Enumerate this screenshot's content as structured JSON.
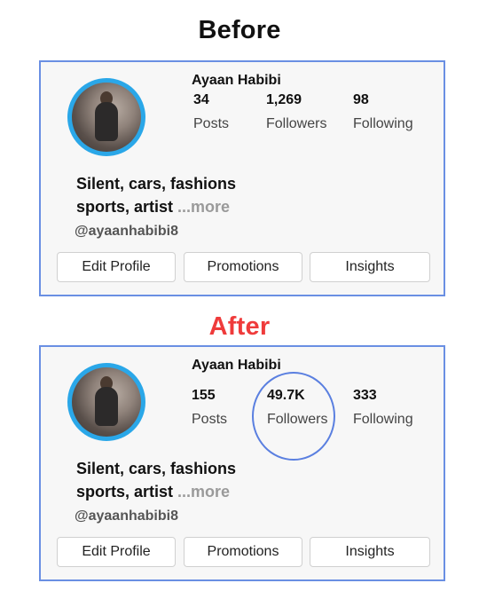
{
  "headings": {
    "before": "Before",
    "after": "After"
  },
  "before": {
    "name": "Ayaan Habibi",
    "stats": [
      {
        "num": "34",
        "label": "Posts"
      },
      {
        "num": "1,269",
        "label": "Followers"
      },
      {
        "num": "98",
        "label": "Following"
      }
    ],
    "bio_line1": "Silent, cars, fashions",
    "bio_line2": "sports, artist",
    "more": "...more",
    "handle": "@ayaanhabibi8",
    "buttons": {
      "edit": "Edit Profile",
      "promotions": "Promotions",
      "insights": "Insights"
    }
  },
  "after": {
    "name": "Ayaan Habibi",
    "stats": [
      {
        "num": "155",
        "label": "Posts"
      },
      {
        "num": "49.7K",
        "label": "Followers"
      },
      {
        "num": "333",
        "label": "Following"
      }
    ],
    "bio_line1": "Silent, cars, fashions",
    "bio_line2": "sports, artist",
    "more": "...more",
    "handle": "@ayaanhabibi8",
    "buttons": {
      "edit": "Edit Profile",
      "promotions": "Promotions",
      "insights": "Insights"
    }
  },
  "colors": {
    "card_border": "#6a8fe3",
    "avatar_ring": "#2aa7e8",
    "after_heading": "#ef3b3b",
    "highlight_circle": "#5a7fe0"
  }
}
